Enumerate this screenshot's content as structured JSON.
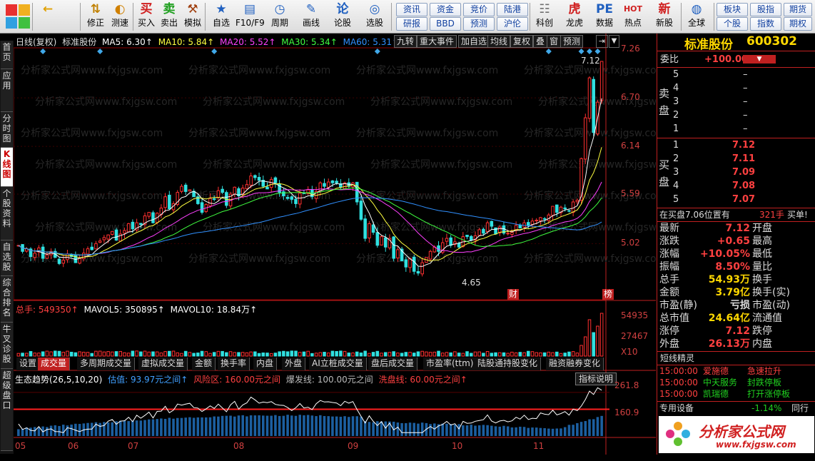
{
  "toolbar": {
    "buttons": [
      {
        "icon": "←",
        "label": ""
      },
      {
        "icon": "⇅",
        "label": "修正"
      },
      {
        "icon": "◐",
        "label": "测速"
      },
      {
        "icon": "买",
        "label": "买入"
      },
      {
        "icon": "卖",
        "label": "卖出"
      },
      {
        "icon": "⚒",
        "label": "模拟"
      },
      {
        "icon": "★",
        "label": "自选"
      },
      {
        "icon": "▤",
        "label": "F10/F9"
      },
      {
        "icon": "◷",
        "label": "周期"
      },
      {
        "icon": "✎",
        "label": "画线"
      },
      {
        "icon": "论",
        "label": "论股"
      },
      {
        "icon": "◎",
        "label": "选股"
      },
      {
        "icon": "☷",
        "label": "科创"
      },
      {
        "icon": "虎",
        "label": "龙虎"
      },
      {
        "icon": "PE",
        "label": "数据"
      },
      {
        "icon": "HOT",
        "label": "热点"
      },
      {
        "icon": "新",
        "label": "新股"
      },
      {
        "icon": "◍",
        "label": "全球"
      }
    ],
    "pills": [
      [
        "资讯",
        "资金",
        "竞价",
        "陆港"
      ],
      [
        "研报",
        "BBD",
        "预测",
        "沪伦"
      ],
      [
        "板块",
        "股指"
      ],
      [
        "个股",
        "指数"
      ],
      [
        "期货",
        "期权"
      ]
    ]
  },
  "left_tabs": [
    {
      "label": "首页",
      "active": false
    },
    {
      "label": "应用",
      "active": false
    },
    {
      "label": "分时图",
      "active": false
    },
    {
      "label": "K线图",
      "active": true
    },
    {
      "label": "个股资料",
      "active": false
    },
    {
      "label": "自选股",
      "active": false
    },
    {
      "label": "综合排名",
      "active": false
    },
    {
      "label": "牛叉诊股",
      "active": false
    },
    {
      "label": "超级盘口",
      "active": false
    }
  ],
  "main_info": {
    "period": "日线(复权)",
    "stock": "标准股份",
    "ma5": "MA5: 6.30↑",
    "ma10": "MA10: 5.84↑",
    "ma20": "MA20: 5.52↑",
    "ma30": "MA30: 5.34↑",
    "ma60": "MA60: 5.31↑"
  },
  "chart_buttons": [
    "九转",
    "重大事件",
    "加自选",
    "均线",
    "复权",
    "叠",
    "窗",
    "预测"
  ],
  "watermark": "分析家公式网www.fxjgsw.com",
  "colors": {
    "up": "#ff3030",
    "down": "#30e0e0",
    "ma5": "#ffffff",
    "ma10": "#ffff40",
    "ma20": "#ff40ff",
    "ma30": "#40ff40",
    "ma60": "#3090ff",
    "accent": "#c02020"
  },
  "chart_data": {
    "type": "candlestick",
    "y_axis_ticks": [
      "7.26",
      "6.70",
      "6.14",
      "5.59",
      "5.02"
    ],
    "ylim": [
      4.48,
      7.26
    ],
    "high_label": "7.12",
    "low_label": "4.65",
    "markers": [
      "财",
      "榜"
    ],
    "x_ticks": [
      "05",
      "06",
      "07",
      "08",
      "09",
      "10",
      "11"
    ],
    "closes": [
      5.0,
      4.93,
      4.96,
      4.87,
      4.91,
      4.97,
      4.85,
      4.89,
      4.93,
      4.86,
      4.79,
      4.83,
      4.9,
      4.87,
      4.8,
      4.85,
      4.91,
      4.96,
      4.95,
      5.02,
      5.05,
      5.09,
      5.12,
      5.16,
      5.06,
      5.13,
      5.17,
      5.25,
      5.19,
      5.26,
      5.24,
      5.34,
      5.38,
      5.26,
      5.37,
      5.43,
      5.56,
      5.42,
      5.48,
      5.61,
      5.68,
      5.62,
      5.64,
      5.56,
      5.48,
      5.38,
      5.47,
      5.54,
      5.53,
      5.63,
      5.61,
      5.46,
      5.59,
      5.67,
      5.57,
      5.66,
      5.7,
      5.8,
      5.78,
      5.75,
      5.68,
      5.65,
      5.76,
      5.72,
      5.61,
      5.57,
      5.54,
      5.53,
      5.48,
      5.6,
      5.6,
      5.64,
      5.56,
      5.62,
      5.72,
      5.68,
      5.73,
      5.72,
      5.72,
      5.67,
      5.72,
      5.68,
      5.72,
      5.5,
      5.3,
      5.08,
      5.25,
      5.15,
      5.0,
      5.1,
      4.98,
      5.08,
      4.85,
      4.95,
      4.82,
      4.75,
      4.85,
      4.7,
      4.68,
      4.8,
      4.86,
      4.93,
      4.98,
      4.93,
      5.03,
      5.08,
      5.0,
      5.04,
      4.98,
      5.1,
      5.1,
      5.06,
      5.11,
      5.18,
      5.14,
      5.26,
      5.22,
      5.13,
      5.21,
      5.14,
      5.14,
      5.15,
      5.23,
      5.2,
      5.26,
      5.23,
      5.28,
      5.29,
      5.32,
      5.3,
      5.35,
      5.45,
      5.38,
      5.44,
      5.42,
      5.4,
      5.5,
      5.52,
      6.0,
      6.47,
      6.93,
      6.3,
      6.65,
      7.12
    ],
    "volume_axis": [
      "54935",
      "27467",
      "X10"
    ],
    "volume_info": {
      "total": "总手: 549350↑",
      "mavol5": "MAVOL5: 350895↑",
      "mavol10": "MAVOL10: 18.84万↑"
    },
    "indicator_info": {
      "name": "生态趋势(26,5,10,20)",
      "valuation": "估值: 93.97元之间↑",
      "risk": "风险区: 160.00元之间",
      "burst": "爆发线: 100.00元之间",
      "low": "洗盘线: 60.00元之间↑"
    },
    "indicator_axis": [
      "261.8",
      "160.9"
    ]
  },
  "tab_bar": [
    "设置",
    "成交量",
    "多周期成交量",
    "虚拟成交量",
    "金额",
    "换手率",
    "内盘",
    "外盘",
    "AI立桩成交量",
    "盘后成交量",
    "市盈率(ttm)",
    "陆股通持股变化",
    "融资融券变化"
  ],
  "indicator_button": "指标说明",
  "panel": {
    "title": "标准股份",
    "code": "600302",
    "weibi_label": "委比",
    "weibi_value": "+100.00%",
    "sell_label": "卖盘",
    "buy_label": "买盘",
    "sell": [
      {
        "n": "5",
        "p": "–"
      },
      {
        "n": "4",
        "p": "–"
      },
      {
        "n": "3",
        "p": "–"
      },
      {
        "n": "2",
        "p": "–"
      },
      {
        "n": "1",
        "p": "–"
      }
    ],
    "buy": [
      {
        "n": "1",
        "p": "7.12"
      },
      {
        "n": "2",
        "p": "7.11"
      },
      {
        "n": "3",
        "p": "7.09"
      },
      {
        "n": "4",
        "p": "7.08"
      },
      {
        "n": "5",
        "p": "7.07"
      }
    ],
    "buy_note": "在买盘7.06位置有",
    "buy_note_qty": "321手",
    "buy_note_tail": "买单!",
    "stats": [
      [
        "最新",
        "7.12",
        "开盘",
        ""
      ],
      [
        "涨跌",
        "+0.65",
        "最高",
        ""
      ],
      [
        "涨幅",
        "+10.05%",
        "最低",
        ""
      ],
      [
        "振幅",
        "8.50%",
        "量比",
        ""
      ],
      [
        "总手",
        "54.93万",
        "换手",
        ""
      ],
      [
        "金额",
        "3.79亿",
        "换手(实)",
        ""
      ],
      [
        "市盈(静)",
        "亏损",
        "市盈(动)",
        ""
      ],
      [
        "总市值",
        "24.64亿",
        "流通值",
        ""
      ],
      [
        "涨停",
        "7.12",
        "跌停",
        ""
      ],
      [
        "外盘",
        "26.13万",
        "内盘",
        ""
      ]
    ],
    "short_title": "短线精灵",
    "short": [
      {
        "t": "15:00:00",
        "name": "爱施德",
        "evt": "急速拉升",
        "c": "red"
      },
      {
        "t": "15:00:00",
        "name": "中天服务",
        "evt": "封跌停板",
        "c": "grn"
      },
      {
        "t": "15:00:00",
        "name": "凯瑞德",
        "evt": "打开涨停板",
        "c": "grn"
      }
    ],
    "sector": "专用设备",
    "sector_chg": "-1.14%",
    "sector_tail": "同行",
    "logo_text": "分析家公式网",
    "logo_url": "www.fxjgsw.com"
  }
}
